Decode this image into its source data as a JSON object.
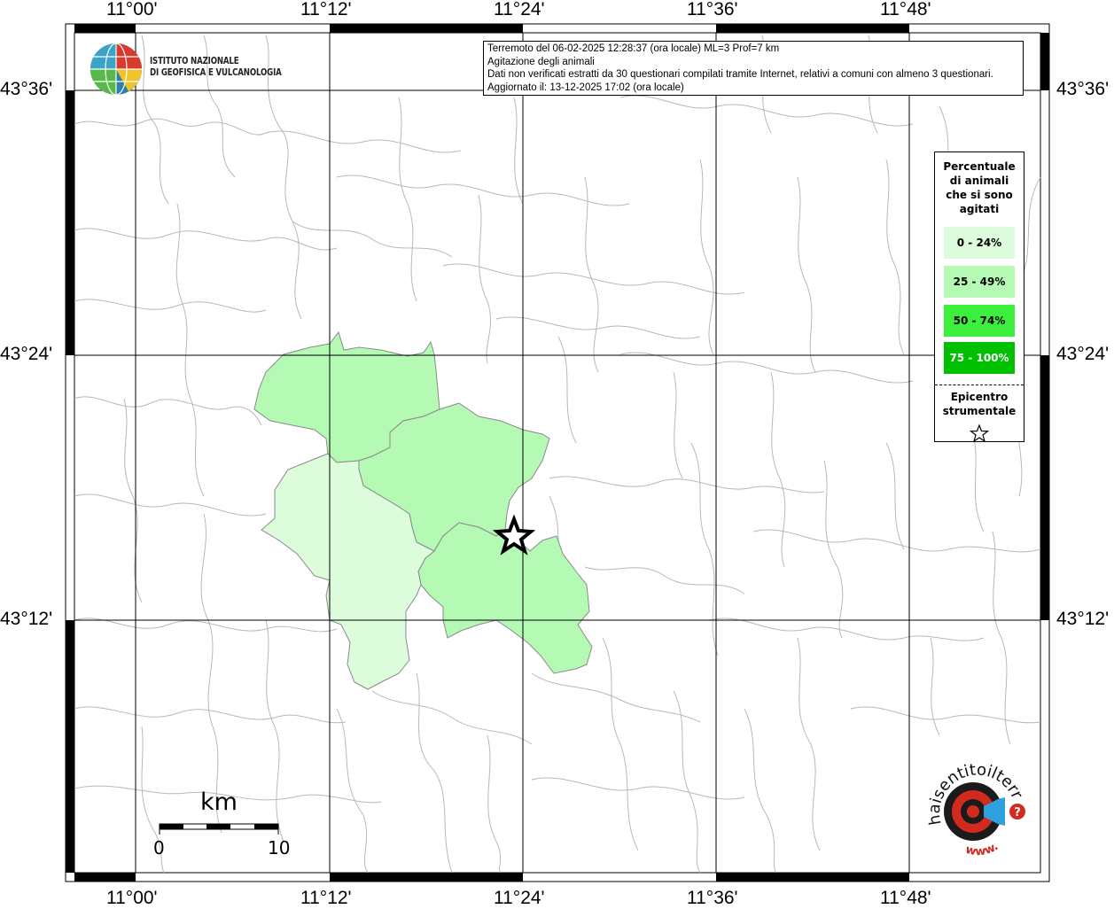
{
  "map": {
    "top_labels": [
      "11°00'",
      "11°12'",
      "11°24'",
      "11°36'",
      "11°48'"
    ],
    "bottom_labels": [
      "11°00'",
      "11°12'",
      "11°24'",
      "11°36'",
      "11°48'"
    ],
    "left_labels": [
      "43°36'",
      "43°24'",
      "43°12'"
    ],
    "right_labels": [
      "43°36'",
      "43°24'",
      "43°12'"
    ]
  },
  "info": {
    "line1": "Terremoto del 06-02-2025 12:28:37 (ora locale) ML=3 Prof=7 km",
    "line2": "Agitazione degli animali",
    "line3": "Dati non verificati estratti da 30 questionari compilati tramite Internet, relativi a comuni con almeno 3 questionari.",
    "line4": "Aggiornato il: 13-12-2025 17:02 (ora locale)"
  },
  "logo": {
    "line1": "ISTITUTO NAZIONALE",
    "line2": "DI GEOFISICA E VULCANOLOGIA"
  },
  "legend": {
    "title1": "Percentuale",
    "title2": "di animali",
    "title3": "che si sono",
    "title4": "agitati",
    "items": [
      {
        "label": "0 - 24%",
        "color": "#dcfcdc"
      },
      {
        "label": "25 - 49%",
        "color": "#b4f9b4"
      },
      {
        "label": "50 - 74%",
        "color": "#3cef3c"
      },
      {
        "label": "75 - 100%",
        "color": "#00c000"
      }
    ],
    "epi1": "Epicentro",
    "epi2": "strumentale"
  },
  "scale": {
    "unit": "km",
    "min": "0",
    "max": "10"
  },
  "site": {
    "text": "haisentitoilterremoto.it",
    "prefix": "www."
  }
}
